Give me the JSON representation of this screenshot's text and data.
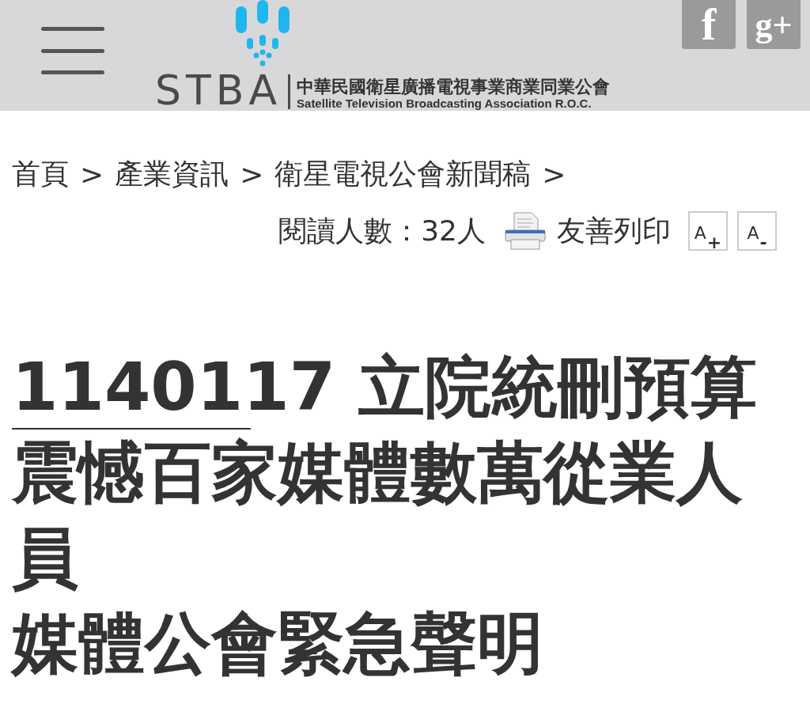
{
  "header": {
    "logo_text": "STBA",
    "org_name_zh": "中華民國衛星廣播電視事業商業同業公會",
    "org_name_en": "Satellite Television Broadcasting Association R.O.C.",
    "social": [
      {
        "kind": "facebook",
        "label": "f"
      },
      {
        "kind": "google",
        "label": "g+"
      }
    ]
  },
  "breadcrumb": [
    {
      "label": "首頁"
    },
    {
      "label": "產業資訊"
    },
    {
      "label": "衛星電視公會新聞稿"
    }
  ],
  "breadcrumb_separator": ">",
  "meta": {
    "views": "閱讀人數：32人",
    "print": "友善列印",
    "font_buttons": [
      {
        "letter": "A",
        "sign": "+"
      },
      {
        "letter": "A",
        "sign": "-"
      }
    ]
  },
  "title_lines": [
    "1140117 立院統刪預算",
    "震憾百家媒體數萬從業人員",
    "媒體公會緊急聲明"
  ]
}
